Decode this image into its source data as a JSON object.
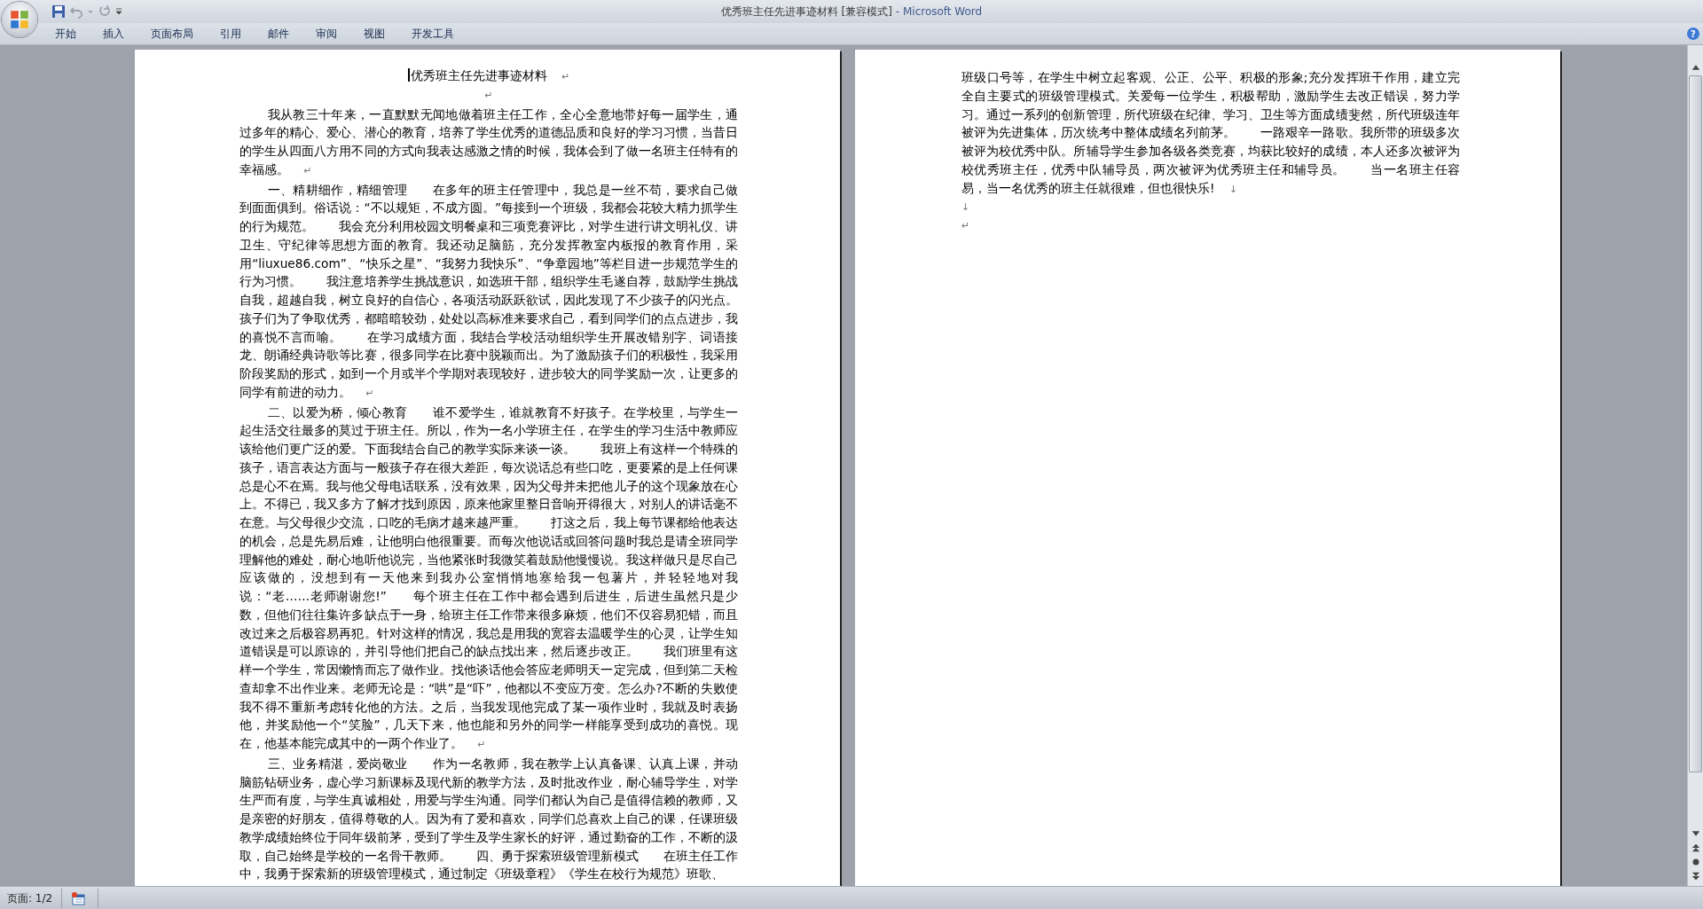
{
  "window": {
    "title": "优秀班主任先进事迹材料 [兼容模式]",
    "app": "- Microsoft Word"
  },
  "ribbon": {
    "tabs": [
      {
        "label": "开始"
      },
      {
        "label": "插入"
      },
      {
        "label": "页面布局"
      },
      {
        "label": "引用"
      },
      {
        "label": "邮件"
      },
      {
        "label": "审阅"
      },
      {
        "label": "视图"
      },
      {
        "label": "开发工具"
      }
    ],
    "help": "?"
  },
  "pages": [
    {
      "paragraphs": [
        {
          "kind": "title",
          "cursor": true,
          "text": "优秀班主任先进事迹材料",
          "end_mark": "↵"
        },
        {
          "kind": "empty",
          "end_mark": "↵"
        },
        {
          "kind": "body",
          "text": "我从教三十年来，一直默默无闻地做着班主任工作，全心全意地带好每一届学生，通过多年的精心、爱心、潜心的教育，培养了学生优秀的道德品质和良好的学习习惯，当昔日的学生从四面八方用不同的方式向我表达感激之情的时候，我体会到了做一名班主任特有的幸福感。",
          "end_mark": "↵"
        },
        {
          "kind": "body",
          "text": "一、精耕细作，精细管理　　在多年的班主任管理中，我总是一丝不苟，要求自己做到面面俱到。俗话说：“不以规矩，不成方圆。”每接到一个班级，我都会花较大精力抓学生的行为规范。　　我会充分利用校园文明餐桌和三项竞赛评比，对学生进行讲文明礼仪、讲卫生、守纪律等思想方面的教育。我还动足脑筋，充分发挥教室内板报的教育作用，采用“liuxue86.com”、“快乐之星”、“我努力我快乐”、“争章园地”等栏目进一步规范学生的行为习惯。　　我注意培养学生挑战意识，如选班干部，组织学生毛遂自荐，鼓励学生挑战自我，超越自我，树立良好的自信心，各项活动跃跃欲试，因此发现了不少孩子的闪光点。孩子们为了争取优秀，都暗暗较劲，处处以高标准来要求自己，看到同学们的点点进步，我的喜悦不言而喻。　　在学习成绩方面，我结合学校活动组织学生开展改错别字、词语接龙、朗诵经典诗歌等比赛，很多同学在比赛中脱颖而出。为了激励孩子们的积极性，我采用阶段奖励的形式，如到一个月或半个学期对表现较好，进步较大的同学奖励一次，让更多的同学有前进的动力。",
          "end_mark": "↵"
        },
        {
          "kind": "body",
          "text": "二、以爱为桥，倾心教育　　谁不爱学生，谁就教育不好孩子。在学校里，与学生一起生活交往最多的莫过于班主任。所以，作为一名小学班主任，在学生的学习生活中教师应该给他们更广泛的爱。下面我结合自己的教学实际来谈一谈。　　我班上有这样一个特殊的孩子，语言表达方面与一般孩子存在很大差距，每次说话总有些口吃，更要紧的是上任何课总是心不在焉。我与他父母电话联系，没有效果，因为父母并未把他儿子的这个现象放在心上。不得已，我又多方了解才找到原因，原来他家里整日音响开得很大，对别人的讲话毫不在意。与父母很少交流，口吃的毛病才越来越严重。　　打这之后，我上每节课都给他表达的机会，总是先易后难，让他明白他很重要。而每次他说话或回答问题时我总是请全班同学理解他的难处，耐心地听他说完，当他紧张时我微笑着鼓励他慢慢说。我这样做只是尽自己应该做的，没想到有一天他来到我办公室悄悄地塞给我一包薯片，并轻轻地对我说：“老……老师谢谢您!”　　每个班主任在工作中都会遇到后进生，后进生虽然只是少数，但他们往往集许多缺点于一身，给班主任工作带来很多麻烦，他们不仅容易犯错，而且改过来之后极容易再犯。针对这样的情况，我总是用我的宽容去温暖学生的心灵，让学生知道错误是可以原谅的，并引导他们把自己的缺点找出来，然后逐步改正。　　我们班里有这样一个学生，常因懒惰而忘了做作业。找他谈话他会答应老师明天一定完成，但到第二天检查却拿不出作业来。老师无论是：“哄”是“吓”，他都以不变应万变。怎么办?不断的失败使我不得不重新考虑转化他的方法。之后，当我发现他完成了某一项作业时，我就及时表扬他，并奖励他一个“笑脸”，几天下来，他也能和另外的同学一样能享受到成功的喜悦。现在，他基本能完成其中的一两个作业了。",
          "end_mark": "↵"
        },
        {
          "kind": "body",
          "text": "三、业务精湛，爱岗敬业　　作为一名教师，我在教学上认真备课、认真上课，并动脑筋钻研业务，虚心学习新课标及现代新的教学方法，及时批改作业，耐心辅导学生，对学生严而有度，与学生真诚相处，用爱与学生沟通。同学们都认为自己是值得信赖的教师，又是亲密的好朋友，值得尊敬的人。因为有了爱和喜欢，同学们总喜欢上自己的课，任课班级教学成绩始终位于同年级前茅，受到了学生及学生家长的好评，通过勤奋的工作，不断的汲取，自己始终是学校的一名骨干教师。　　四、勇于探索班级管理新模式　　在班主任工作中，我勇于探索新的班级管理模式，通过制定《班级章程》《学生在校行为规范》班歌、"
        }
      ]
    },
    {
      "paragraphs": [
        {
          "kind": "continuation",
          "text": "班级口号等，在学生中树立起客观、公正、公平、积极的形象;充分发挥班干作用，建立完全自主要式的班级管理模式。关爱每一位学生，积极帮助，激励学生去改正错误，努力学习。通过一系列的创新管理，所代班级在纪律、学习、卫生等方面成绩斐然，所代班级连年被评为先进集体，历次统考中整体成绩名列前茅。　　一路艰辛一路歌。我所带的班级多次被评为校优秀中队。所辅导学生参加各级各类竞赛，均获比较好的成绩，本人还多次被评为校优秀班主任，优秀中队辅导员，两次被评为优秀班主任和辅导员。　　当一名班主任容易，当一名优秀的班主任就很难，但也很快乐!",
          "end_mark": "↓"
        },
        {
          "kind": "empty",
          "end_mark": "↓"
        },
        {
          "kind": "empty",
          "end_mark": "↵"
        }
      ]
    }
  ],
  "status_bar": {
    "page": "页面: 1/2"
  }
}
